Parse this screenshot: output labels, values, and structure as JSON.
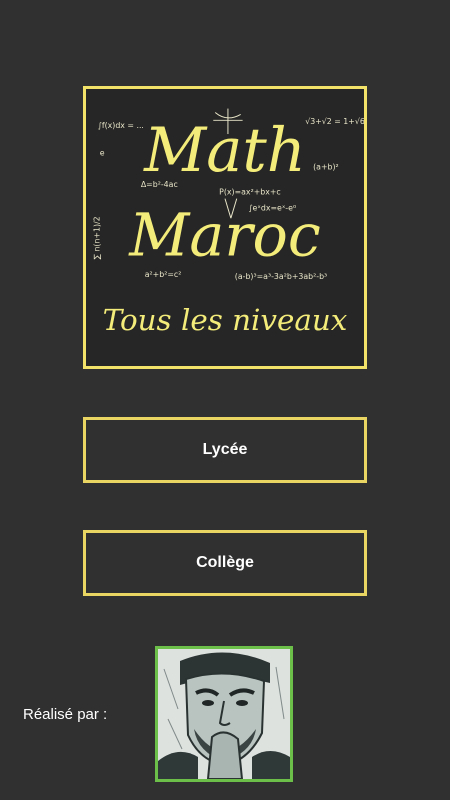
{
  "logo": {
    "title_line1": "Math",
    "title_line2": "Maroc",
    "subtitle": "Tous les niveaux",
    "formulas": {
      "f1": "∫f(x)dx = ... ",
      "f2": "√3+√2 = 1+√6",
      "f3": "Δ=b²-4ac",
      "f4": "P(x)=ax²+bx+c",
      "f5": "(a-b)³=a³-3a²b+3ab²-b³",
      "f6": "a²+b²=c²",
      "f7": "∑ n(n+1)/2",
      "f8": "∫eˣdx=eˣ-e⁰",
      "f9": "e",
      "f10": "(a+b)²"
    },
    "accent_color": "#f4ec7a"
  },
  "buttons": {
    "lycee_label": "Lycée",
    "college_label": "Collège",
    "border_color": "#e9d561"
  },
  "footer": {
    "credit_label": "Réalisé par :",
    "photo_border_color": "#6cc04a"
  },
  "background_color": "#303030"
}
